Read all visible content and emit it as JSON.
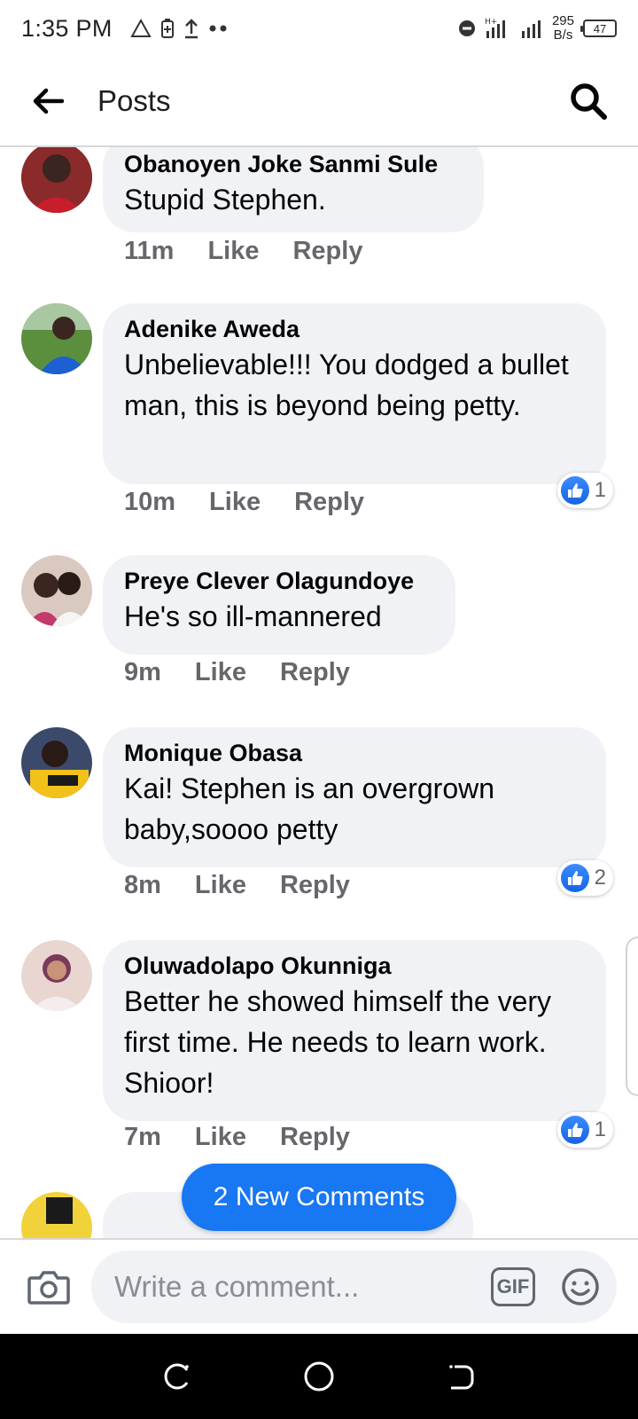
{
  "status_bar": {
    "time": "1:35 PM",
    "net_speed_value": "295",
    "net_speed_unit": "B/s",
    "battery": "47",
    "network": "H+"
  },
  "header": {
    "title": "Posts"
  },
  "comments": [
    {
      "author": "Obanoyen Joke Sanmi Sule",
      "text": "Stupid Stephen.",
      "time": "11m",
      "like_label": "Like",
      "reply_label": "Reply",
      "reactions": null,
      "avatar_color": "#c81e2c"
    },
    {
      "author": "Adenike Aweda",
      "text": "Unbelievable!!! You dodged a bullet man, this is beyond being petty.",
      "time": "10m",
      "like_label": "Like",
      "reply_label": "Reply",
      "reactions": "1",
      "avatar_color": "#2f7d3a"
    },
    {
      "author": "Preye Clever Olagundoye",
      "text": "He's so ill-mannered",
      "time": "9m",
      "like_label": "Like",
      "reply_label": "Reply",
      "reactions": null,
      "avatar_color": "#6b4a3a"
    },
    {
      "author": "Monique Obasa",
      "text": "Kai! Stephen is an overgrown baby,soooo petty",
      "time": "8m",
      "like_label": "Like",
      "reply_label": "Reply",
      "reactions": "2",
      "avatar_color": "#e0b11a"
    },
    {
      "author": "Oluwadolapo Okunniga",
      "text": "Better he showed himself the very first time. He needs to learn work. Shioor!",
      "time": "7m",
      "like_label": "Like",
      "reply_label": "Reply",
      "reactions": "1",
      "avatar_color": "#d9a6b5"
    }
  ],
  "new_comments_label": "2 New Comments",
  "composer": {
    "placeholder": "Write a comment...",
    "gif_label": "GIF"
  },
  "colors": {
    "accent": "#1877f2",
    "bubble": "#f0f2f5",
    "meta": "#65676b"
  }
}
